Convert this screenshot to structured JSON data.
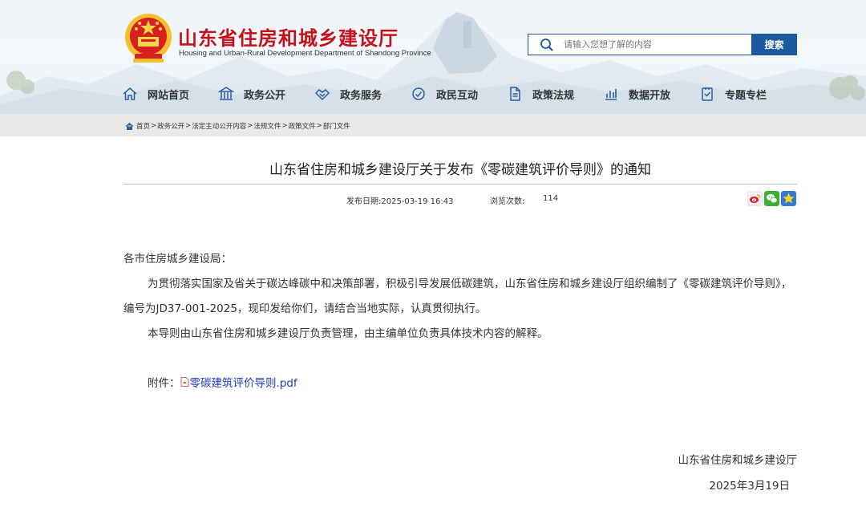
{
  "header": {
    "site_title": "山东省住房和城乡建设厅",
    "site_subtitle": "Housing and Urban-Rural Development Department of Shandong Province",
    "emblem_icon": "national-emblem-icon",
    "search": {
      "placeholder": "请输入您想了解的内容",
      "button_label": "搜索"
    }
  },
  "nav": {
    "items": [
      {
        "label": "网站首页",
        "icon": "home-icon"
      },
      {
        "label": "政务公开",
        "icon": "building-icon"
      },
      {
        "label": "政务服务",
        "icon": "handshake-icon"
      },
      {
        "label": "政民互动",
        "icon": "interaction-icon"
      },
      {
        "label": "政策法规",
        "icon": "document-icon"
      },
      {
        "label": "数据开放",
        "icon": "bar-chart-icon"
      },
      {
        "label": "专题专栏",
        "icon": "topic-icon"
      }
    ]
  },
  "breadcrumb": {
    "items": [
      "首页",
      "政务公开",
      "法定主动公开内容",
      "法规文件",
      "政策文件",
      "部门文件"
    ],
    "separator": ">"
  },
  "article": {
    "title": "山东省住房和城乡建设厅关于发布《零碳建筑评价导则》的通知",
    "date_label": "发布日期:2025-03-19 16:43",
    "views_label": "浏览次数:",
    "views_value": "114",
    "share_icons": [
      "weibo-icon",
      "wechat-icon",
      "favorite-star-icon"
    ],
    "salutation": "各市住房城乡建设局：",
    "paragraph_1": "为贯彻落实国家及省关于碳达峰碳中和决策部署，积极引导发展低碳建筑，山东省住房和城乡建设厅组织编制了《零碳建筑评价导则》，编号为JD37-001-2025，现印发给你们，请结合当地实际，认真贯彻执行。",
    "paragraph_2": "本导则由山东省住房和城乡建设厅负责管理，由主编单位负责具体技术内容的解释。",
    "attachment_label": "附件：",
    "attachment_link": "零碳建筑评价导则.pdf",
    "signature_org": "山东省住房和城乡建设厅",
    "signature_date": "2025年3月19日"
  },
  "colors": {
    "brand_red": "#c4121a",
    "brand_blue": "#1b5a9e",
    "link_blue": "#1a3fb5",
    "breadcrumb_bg": "#e9e9e9"
  }
}
